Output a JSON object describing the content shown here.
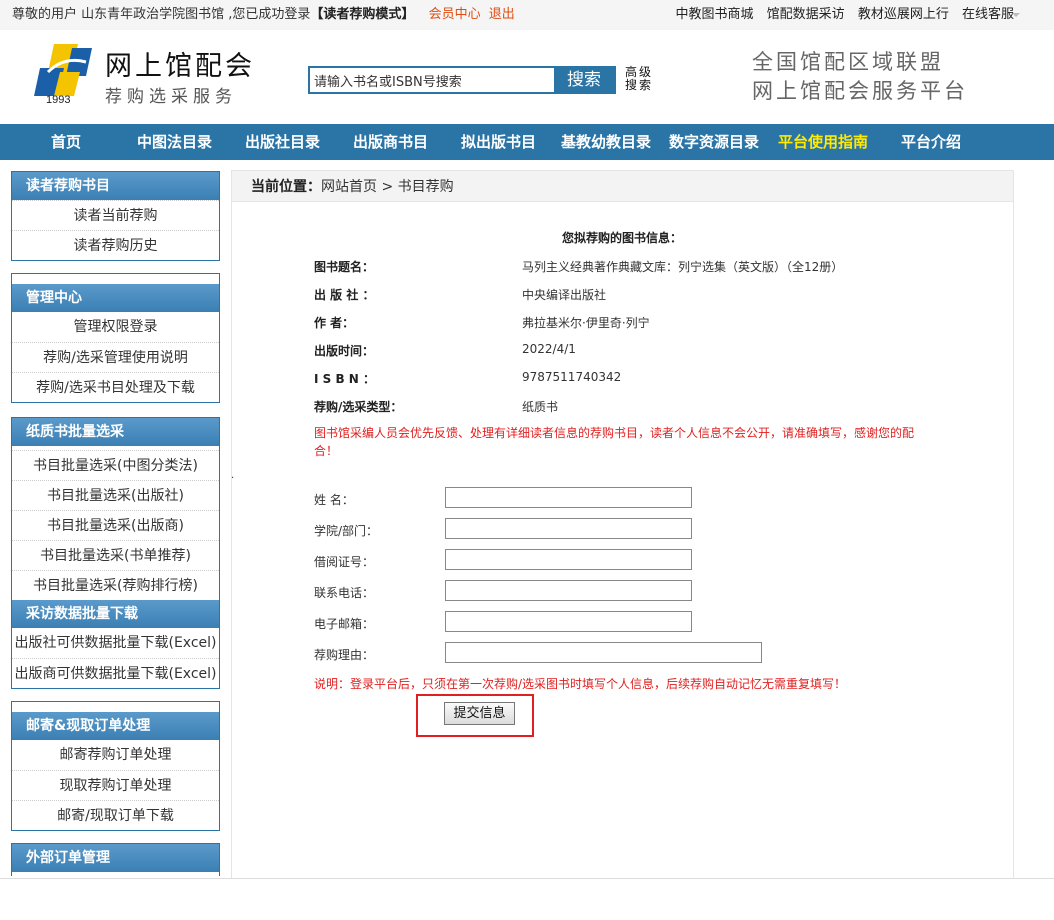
{
  "topbar": {
    "greeting": "尊敬的用户  山东青年政治学院图书馆 ,您已成功登录",
    "mode": "【读者荐购模式】",
    "member_center": "会员中心",
    "logout": "退出",
    "links": [
      "中教图书商城",
      "馆配数据采访",
      "教材巡展网上行",
      "在线客服"
    ]
  },
  "header": {
    "logo_year": "1993",
    "logo_title": "网上馆配会",
    "logo_subtitle": "荐购选采服务",
    "search_placeholder": "请输入书名或ISBN号搜索",
    "search_button": "搜索",
    "advanced_search": "高级搜索",
    "union_line1": "全国馆配区域联盟",
    "union_line2": "网上馆配会服务平台"
  },
  "nav": [
    "首页",
    "中图法目录",
    "出版社目录",
    "出版商书目",
    "拟出版书目",
    "基教幼教目录",
    "数字资源目录",
    "平台使用指南",
    "平台介绍"
  ],
  "nav_highlight": "平台使用指南",
  "sidebar": {
    "reader": {
      "title": "读者荐购书目",
      "items": [
        "读者当前荐购",
        "读者荐购历史"
      ]
    },
    "admin": {
      "title": "管理中心",
      "items": [
        "管理权限登录",
        "荐购/选采管理使用说明",
        "荐购/选采书目处理及下载"
      ]
    },
    "batch": {
      "title": "纸质书批量选采",
      "items": [
        "书目批量选采(中图分类法)",
        "书目批量选采(出版社)",
        "书目批量选采(出版商)",
        "书目批量选采(书单推荐)",
        "书目批量选采(荐购排行榜)"
      ]
    },
    "download": {
      "title": "采访数据批量下载",
      "items": [
        "出版社可供数据批量下载(Excel)",
        "出版商可供数据批量下载(Excel)"
      ]
    },
    "mail": {
      "title": "邮寄&现取订单处理",
      "items": [
        "邮寄荐购订单处理",
        "现取荐购订单处理",
        "邮寄/现取订单下载"
      ]
    },
    "external": {
      "title": "外部订单管理"
    }
  },
  "breadcrumb": {
    "label": "当前位置：",
    "path": "网站首页 > 书目荐购"
  },
  "book_info": {
    "title": "您拟荐购的图书信息：",
    "rows": [
      {
        "label": "图书题名：",
        "value": "马列主义经典著作典藏文库：列宁选集（英文版）（全12册）"
      },
      {
        "label": "出 版 社 ：",
        "value": "中央编译出版社"
      },
      {
        "label": "作    者：",
        "value": "弗拉基米尔·伊里奇·列宁"
      },
      {
        "label": "出版时间：",
        "value": "2022/4/1"
      },
      {
        "label": "I S B N ：",
        "value": "9787511740342"
      },
      {
        "label": "荐购/选采类型：",
        "value": "纸质书"
      }
    ],
    "notice": "图书馆采编人员会优先反馈、处理有详细读者信息的荐购书目，读者个人信息不会公开，请准确填写，感谢您的配合！"
  },
  "form": {
    "fields": [
      {
        "label": "姓    名：",
        "value": ""
      },
      {
        "label": "学院/部门：",
        "value": ""
      },
      {
        "label": "借阅证号：",
        "value": ""
      },
      {
        "label": "联系电话：",
        "value": ""
      },
      {
        "label": "电子邮箱：",
        "value": ""
      },
      {
        "label": "荐购理由：",
        "value": ""
      }
    ],
    "note": "说明：登录平台后，只须在第一次荐购/选采图书时填写个人信息，后续荐购自动记忆无需重复填写！",
    "submit": "提交信息"
  },
  "colors": {
    "nav_bg": "#2a74a6",
    "nav_highlight": "#ffea00",
    "accent_orange": "#e04d14",
    "alert_red": "#e02020",
    "logo_blue": "#1a5fa8",
    "logo_yellow": "#f5c400"
  }
}
